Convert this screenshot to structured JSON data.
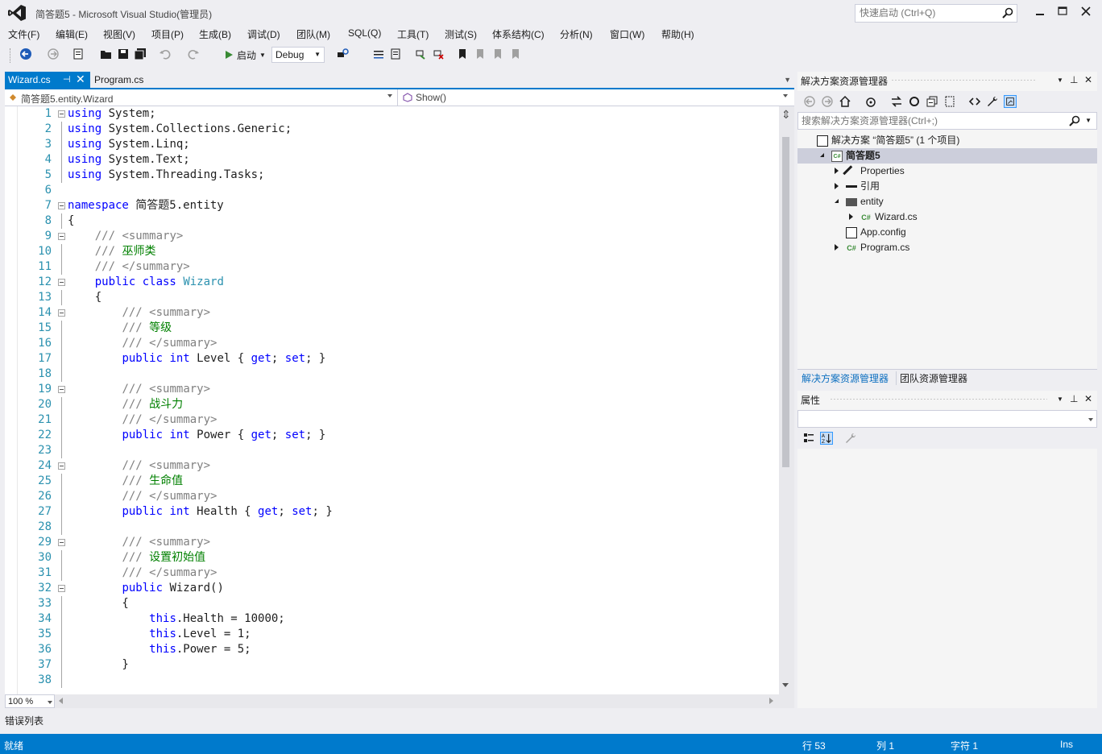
{
  "window": {
    "title": "简答题5 - Microsoft Visual Studio(管理员)",
    "quick_launch_placeholder": "快速启动 (Ctrl+Q)"
  },
  "menu": [
    "文件(F)",
    "编辑(E)",
    "视图(V)",
    "项目(P)",
    "生成(B)",
    "调试(D)",
    "团队(M)",
    "SQL(Q)",
    "工具(T)",
    "测试(S)",
    "体系结构(C)",
    "分析(N)",
    "窗口(W)",
    "帮助(H)"
  ],
  "toolbar": {
    "start_label": "启动",
    "configuration": "Debug"
  },
  "editor": {
    "tabs": [
      {
        "label": "Wizard.cs",
        "active": true
      },
      {
        "label": "Program.cs",
        "active": false
      }
    ],
    "nav_type": "简答题5.entity.Wizard",
    "nav_member": "Show()",
    "zoom": "100 %",
    "lines": [
      {
        "n": "1",
        "fold": "start",
        "tokens": [
          [
            "kw",
            "using"
          ],
          [
            "",
            "System;"
          ]
        ]
      },
      {
        "n": "2",
        "fold": "mid",
        "tokens": [
          [
            "kw",
            "using"
          ],
          [
            "",
            "System.Collections.Generic;"
          ]
        ]
      },
      {
        "n": "3",
        "fold": "mid",
        "tokens": [
          [
            "kw",
            "using"
          ],
          [
            "",
            "System.Linq;"
          ]
        ]
      },
      {
        "n": "4",
        "fold": "mid",
        "tokens": [
          [
            "kw",
            "using"
          ],
          [
            "",
            "System.Text;"
          ]
        ]
      },
      {
        "n": "5",
        "fold": "mid",
        "tokens": [
          [
            "kw",
            "using"
          ],
          [
            "",
            "System.Threading.Tasks;"
          ]
        ]
      },
      {
        "n": "6",
        "fold": "",
        "tokens": []
      },
      {
        "n": "7",
        "fold": "start",
        "tokens": [
          [
            "kw",
            "namespace"
          ],
          [
            "",
            "简答题5.entity"
          ]
        ]
      },
      {
        "n": "8",
        "fold": "mid",
        "tokens": [
          [
            "",
            "{"
          ]
        ]
      },
      {
        "n": "9",
        "fold": "start",
        "tokens": [
          [
            "",
            "    "
          ],
          [
            "dc",
            "///"
          ],
          [
            "cm",
            " "
          ],
          [
            "dc",
            "<summary>"
          ]
        ]
      },
      {
        "n": "10",
        "fold": "mid",
        "tokens": [
          [
            "",
            "    "
          ],
          [
            "dc",
            "///"
          ],
          [
            "cm",
            " 巫师类"
          ]
        ]
      },
      {
        "n": "11",
        "fold": "mid",
        "tokens": [
          [
            "",
            "    "
          ],
          [
            "dc",
            "///"
          ],
          [
            "cm",
            " "
          ],
          [
            "dc",
            "</summary>"
          ]
        ]
      },
      {
        "n": "12",
        "fold": "start",
        "tokens": [
          [
            "",
            "    "
          ],
          [
            "kw",
            "public class"
          ],
          [
            "",
            ""
          ],
          [
            "ty",
            "Wizard"
          ]
        ]
      },
      {
        "n": "13",
        "fold": "mid",
        "tokens": [
          [
            "",
            "    {"
          ]
        ]
      },
      {
        "n": "14",
        "fold": "start",
        "tokens": [
          [
            "",
            "        "
          ],
          [
            "dc",
            "///"
          ],
          [
            "cm",
            " "
          ],
          [
            "dc",
            "<summary>"
          ]
        ]
      },
      {
        "n": "15",
        "fold": "mid",
        "tokens": [
          [
            "",
            "        "
          ],
          [
            "dc",
            "///"
          ],
          [
            "cm",
            " 等级"
          ]
        ]
      },
      {
        "n": "16",
        "fold": "mid",
        "tokens": [
          [
            "",
            "        "
          ],
          [
            "dc",
            "///"
          ],
          [
            "cm",
            " "
          ],
          [
            "dc",
            "</summary>"
          ]
        ]
      },
      {
        "n": "17",
        "fold": "mid",
        "tokens": [
          [
            "",
            "        "
          ],
          [
            "kw",
            "public int"
          ],
          [
            "",
            "Level { "
          ],
          [
            "kw",
            "get"
          ],
          [
            "",
            "; "
          ],
          [
            "kw",
            "set"
          ],
          [
            "",
            "; }"
          ]
        ]
      },
      {
        "n": "18",
        "fold": "mid",
        "tokens": []
      },
      {
        "n": "19",
        "fold": "start",
        "tokens": [
          [
            "",
            "        "
          ],
          [
            "dc",
            "///"
          ],
          [
            "cm",
            " "
          ],
          [
            "dc",
            "<summary>"
          ]
        ]
      },
      {
        "n": "20",
        "fold": "mid",
        "tokens": [
          [
            "",
            "        "
          ],
          [
            "dc",
            "///"
          ],
          [
            "cm",
            " 战斗力"
          ]
        ]
      },
      {
        "n": "21",
        "fold": "mid",
        "tokens": [
          [
            "",
            "        "
          ],
          [
            "dc",
            "///"
          ],
          [
            "cm",
            " "
          ],
          [
            "dc",
            "</summary>"
          ]
        ]
      },
      {
        "n": "22",
        "fold": "mid",
        "tokens": [
          [
            "",
            "        "
          ],
          [
            "kw",
            "public int"
          ],
          [
            "",
            "Power { "
          ],
          [
            "kw",
            "get"
          ],
          [
            "",
            "; "
          ],
          [
            "kw",
            "set"
          ],
          [
            "",
            "; }"
          ]
        ]
      },
      {
        "n": "23",
        "fold": "mid",
        "tokens": []
      },
      {
        "n": "24",
        "fold": "start",
        "tokens": [
          [
            "",
            "        "
          ],
          [
            "dc",
            "///"
          ],
          [
            "cm",
            " "
          ],
          [
            "dc",
            "<summary>"
          ]
        ]
      },
      {
        "n": "25",
        "fold": "mid",
        "tokens": [
          [
            "",
            "        "
          ],
          [
            "dc",
            "///"
          ],
          [
            "cm",
            " 生命值"
          ]
        ]
      },
      {
        "n": "26",
        "fold": "mid",
        "tokens": [
          [
            "",
            "        "
          ],
          [
            "dc",
            "///"
          ],
          [
            "cm",
            " "
          ],
          [
            "dc",
            "</summary>"
          ]
        ]
      },
      {
        "n": "27",
        "fold": "mid",
        "tokens": [
          [
            "",
            "        "
          ],
          [
            "kw",
            "public int"
          ],
          [
            "",
            "Health { "
          ],
          [
            "kw",
            "get"
          ],
          [
            "",
            "; "
          ],
          [
            "kw",
            "set"
          ],
          [
            "",
            "; }"
          ]
        ]
      },
      {
        "n": "28",
        "fold": "mid",
        "tokens": []
      },
      {
        "n": "29",
        "fold": "start",
        "tokens": [
          [
            "",
            "        "
          ],
          [
            "dc",
            "///"
          ],
          [
            "cm",
            " "
          ],
          [
            "dc",
            "<summary>"
          ]
        ]
      },
      {
        "n": "30",
        "fold": "mid",
        "tokens": [
          [
            "",
            "        "
          ],
          [
            "dc",
            "///"
          ],
          [
            "cm",
            " 设置初始值"
          ]
        ]
      },
      {
        "n": "31",
        "fold": "mid",
        "tokens": [
          [
            "",
            "        "
          ],
          [
            "dc",
            "///"
          ],
          [
            "cm",
            " "
          ],
          [
            "dc",
            "</summary>"
          ]
        ]
      },
      {
        "n": "32",
        "fold": "start",
        "tokens": [
          [
            "",
            "        "
          ],
          [
            "kw",
            "public"
          ],
          [
            "",
            "Wizard()"
          ]
        ]
      },
      {
        "n": "33",
        "fold": "mid",
        "tokens": [
          [
            "",
            "        {"
          ]
        ]
      },
      {
        "n": "34",
        "fold": "mid",
        "tokens": [
          [
            "",
            "            "
          ],
          [
            "kw",
            "this"
          ],
          [
            "",
            ".Health = 10000;"
          ]
        ]
      },
      {
        "n": "35",
        "fold": "mid",
        "tokens": [
          [
            "",
            "            "
          ],
          [
            "kw",
            "this"
          ],
          [
            "",
            ".Level = 1;"
          ]
        ]
      },
      {
        "n": "36",
        "fold": "mid",
        "tokens": [
          [
            "",
            "            "
          ],
          [
            "kw",
            "this"
          ],
          [
            "",
            ".Power = 5;"
          ]
        ]
      },
      {
        "n": "37",
        "fold": "mid",
        "tokens": [
          [
            "",
            "        }"
          ]
        ]
      },
      {
        "n": "38",
        "fold": "mid",
        "tokens": []
      }
    ]
  },
  "solution_explorer": {
    "title": "解决方案资源管理器",
    "search_placeholder": "搜索解决方案资源管理器(Ctrl+;)",
    "tree": [
      {
        "label": "解决方案 “简答题5” (1 个项目)",
        "indent": 0,
        "expander": "",
        "icon": "solution-icon",
        "icon_text": "",
        "selected": false
      },
      {
        "label": "简答题5",
        "indent": 1,
        "expander": "expanded",
        "icon": "csharp-project-icon",
        "icon_text": "C#",
        "selected": true
      },
      {
        "label": "Properties",
        "indent": 2,
        "expander": "collapsed",
        "icon": "wrench-icon",
        "icon_text": "",
        "selected": false
      },
      {
        "label": "引用",
        "indent": 2,
        "expander": "collapsed",
        "icon": "references-icon",
        "icon_text": "",
        "selected": false
      },
      {
        "label": "entity",
        "indent": 2,
        "expander": "expanded",
        "icon": "folder-icon",
        "icon_text": "",
        "selected": false
      },
      {
        "label": "Wizard.cs",
        "indent": 3,
        "expander": "collapsed",
        "icon": "csharp-file-icon",
        "icon_text": "C#",
        "selected": false
      },
      {
        "label": "App.config",
        "indent": 2,
        "expander": "",
        "icon": "config-file-icon",
        "icon_text": "",
        "selected": false
      },
      {
        "label": "Program.cs",
        "indent": 2,
        "expander": "collapsed",
        "icon": "csharp-file-icon",
        "icon_text": "C#",
        "selected": false
      }
    ],
    "bottom_tabs": [
      "解决方案资源管理器",
      "团队资源管理器"
    ]
  },
  "properties": {
    "title": "属性"
  },
  "error_list_label": "错误列表",
  "status": {
    "ready": "就绪",
    "line": "行 53",
    "col": "列 1",
    "char": "字符 1",
    "mode": "Ins"
  },
  "colors": {
    "accent": "#007ACC",
    "keyword": "#0000FF",
    "type": "#2B91AF",
    "comment": "#008000"
  }
}
